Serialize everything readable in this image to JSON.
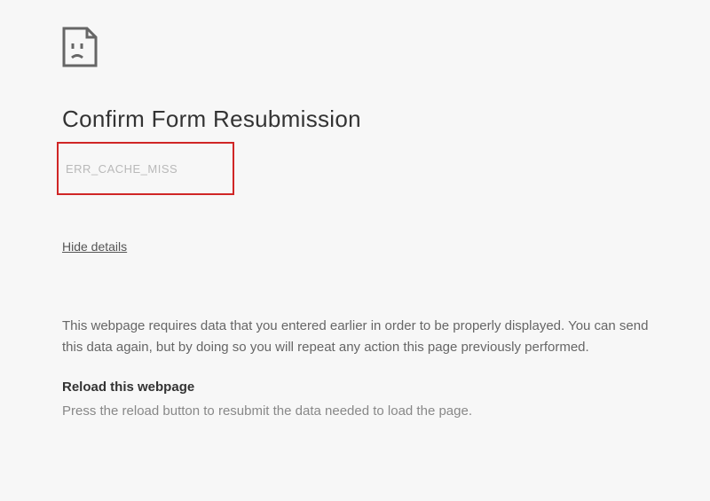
{
  "title": "Confirm Form Resubmission",
  "error_code": "ERR_CACHE_MISS",
  "hide_details_label": "Hide details",
  "explanation": "This webpage requires data that you entered earlier in order to be properly displayed. You can send this data again, but by doing so you will repeat any action this page previously performed.",
  "reload_heading": "Reload this webpage",
  "reload_text": "Press the reload button to resubmit the data needed to load the page."
}
